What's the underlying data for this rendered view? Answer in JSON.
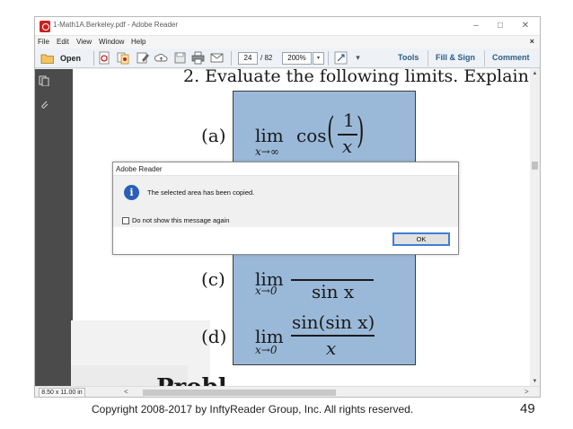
{
  "window": {
    "title": "1-Math1A.Berkeley.pdf - Adobe Reader",
    "minimize": "–",
    "maximize": "□",
    "close": "✕"
  },
  "menu": {
    "items": [
      "File",
      "Edit",
      "View",
      "Window",
      "Help"
    ],
    "close_doc": "×"
  },
  "toolbar": {
    "open_label": "Open",
    "page_current": "24",
    "page_total": "/ 82",
    "zoom": "200%",
    "zoom_dropdown": "▾",
    "links": [
      "Tools",
      "Fill & Sign",
      "Comment"
    ],
    "icons": [
      "open-folder-icon",
      "create-pdf-icon",
      "combine-icon",
      "edit-icon",
      "cloud-icon",
      "save-icon",
      "print-icon",
      "email-icon",
      "select-tool-icon"
    ]
  },
  "document": {
    "heading": "2.  Evaluate the following limits.  Explain",
    "items": [
      {
        "label": "(a)",
        "lim": "lim",
        "sub": "x→∞",
        "expr": "cos"
      },
      {
        "label": "(c)",
        "lim": "lim",
        "sub": "x→0",
        "expr_den": "sin x"
      },
      {
        "label": "(d)",
        "lim": "lim",
        "sub": "x→0",
        "expr_num": "sin(sin x)",
        "expr_den": "x"
      }
    ],
    "frac_a_num": "1",
    "frac_a_den": "x",
    "bottom_text": "Probl"
  },
  "dialog": {
    "title": "Adobe Reader",
    "message": "The selected area has been copied.",
    "checkbox_label": "Do not show this message again",
    "checkbox_checked": false,
    "ok_label": "OK",
    "info_glyph": "i"
  },
  "statusbar": {
    "page_size": "8.50 x 11.00 in",
    "scroll_left": "<",
    "scroll_right": ">"
  },
  "footer": {
    "copyright": "Copyright 2008-2017 by InftyReader Group, Inc. All rights reserved.",
    "page_number": "49"
  },
  "colors": {
    "selection_blue": "#9ab9d9",
    "toolbar_link": "#2d5b88",
    "info_icon": "#2a5fb8",
    "ok_border": "#3e7fd2",
    "nav_dark": "#4b4b4b"
  }
}
